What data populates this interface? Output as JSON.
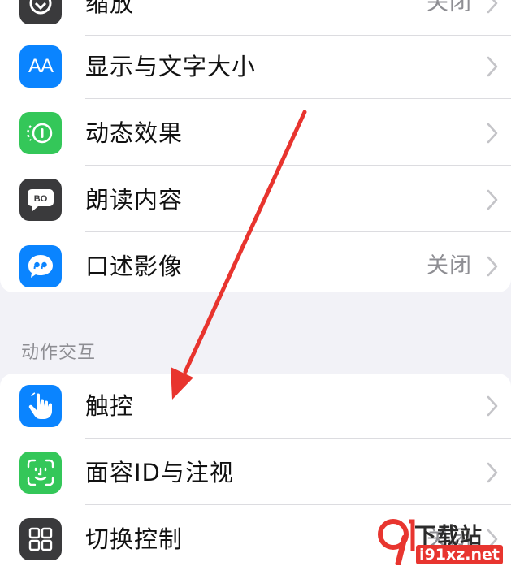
{
  "section_top": {
    "items": [
      {
        "label": "缩放",
        "value": "关闭",
        "icon": "zoom-icon",
        "color": "#3a3a3c"
      },
      {
        "label": "显示与文字大小",
        "value": "",
        "icon": "text-size-icon",
        "color": "#0a84ff"
      },
      {
        "label": "动态效果",
        "value": "",
        "icon": "motion-icon",
        "color": "#34c759"
      },
      {
        "label": "朗读内容",
        "value": "",
        "icon": "spoken-content-icon",
        "color": "#3a3a3c"
      },
      {
        "label": "口述影像",
        "value": "关闭",
        "icon": "audio-descriptions-icon",
        "color": "#0a84ff"
      }
    ]
  },
  "section_interaction": {
    "header": "动作交互",
    "items": [
      {
        "label": "触控",
        "value": "",
        "icon": "touch-icon",
        "color": "#0a84ff"
      },
      {
        "label": "面容ID与注视",
        "value": "",
        "icon": "face-id-icon",
        "color": "#34c759"
      },
      {
        "label": "切换控制",
        "value": "关闭",
        "icon": "switch-control-icon",
        "color": "#3a3a3c"
      }
    ]
  },
  "icon_glyphs": {
    "text_size": "AA",
    "spoken": "BO"
  },
  "annotation": {
    "arrow_color": "#e8342e"
  },
  "watermark": {
    "site": "下载站",
    "url": "i91xz.net",
    "brand_color": "#e8352f"
  }
}
